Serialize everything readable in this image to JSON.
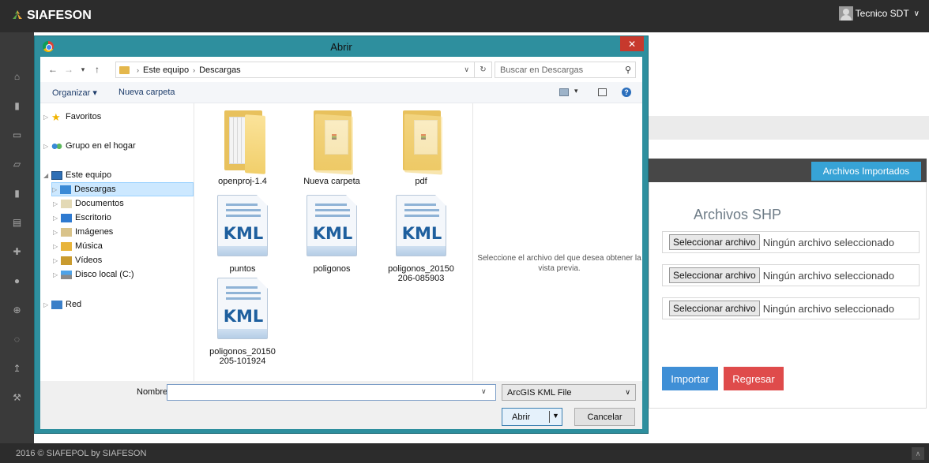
{
  "app": {
    "brand": "SIAFESON",
    "user": "Tecnico SDT",
    "user_chevron": "∨"
  },
  "sidebar": {
    "icons": [
      {
        "name": "home-icon",
        "glyph": "⌂"
      },
      {
        "name": "book-icon",
        "glyph": "▮"
      },
      {
        "name": "folder-icon",
        "glyph": "▭"
      },
      {
        "name": "folder-open-icon",
        "glyph": "▱"
      },
      {
        "name": "book2-icon",
        "glyph": "▮"
      },
      {
        "name": "file-icon",
        "glyph": "▤"
      },
      {
        "name": "puzzle-icon",
        "glyph": "✚"
      },
      {
        "name": "circle-icon",
        "glyph": "●"
      },
      {
        "name": "plus-circle-icon",
        "glyph": "⊕"
      },
      {
        "name": "spinner-icon",
        "glyph": "◌"
      },
      {
        "name": "upload-icon",
        "glyph": "↥"
      },
      {
        "name": "wrench-icon",
        "glyph": "⚒"
      }
    ]
  },
  "panel": {
    "imported_button": "Archivos Importados",
    "title": "Archivos SHP",
    "file_rows": [
      {
        "button": "Seleccionar archivo",
        "status": "Ningún archivo seleccionado"
      },
      {
        "button": "Seleccionar archivo",
        "status": "Ningún archivo seleccionado"
      },
      {
        "button": "Seleccionar archivo",
        "status": "Ningún archivo seleccionado"
      }
    ],
    "import_button": "Importar",
    "back_button": "Regresar"
  },
  "footer": {
    "text": "2016 © SIAFEPOL by SIAFESON",
    "up_icon": "∧"
  },
  "dialog": {
    "title": "Abrir",
    "close": "✕",
    "address": {
      "root": "Este equipo",
      "folder": "Descargas",
      "sep": "›",
      "chevron": "∨",
      "refresh": "↻"
    },
    "search_placeholder": "Buscar en Descargas",
    "nav": {
      "back": "←",
      "forward": "→",
      "dropdown": "▾",
      "up": "↑"
    },
    "toolbar": {
      "organize": "Organizar ▾",
      "new_folder": "Nueva carpeta",
      "view_dd": "▾",
      "help": "?"
    },
    "tree": {
      "favorites": "Favoritos",
      "homegroup": "Grupo en el hogar",
      "this_pc": "Este equipo",
      "children": [
        "Descargas",
        "Documentos",
        "Escritorio",
        "Imágenes",
        "Música",
        "Vídeos",
        "Disco local (C:)"
      ],
      "network": "Red"
    },
    "files": [
      {
        "name": "openproj-1.4",
        "type": "folder-doc"
      },
      {
        "name": "Nueva carpeta",
        "type": "folder"
      },
      {
        "name": "pdf",
        "type": "folder"
      },
      {
        "name": "puntos",
        "type": "kml"
      },
      {
        "name": "poligonos",
        "type": "kml"
      },
      {
        "name": "poligonos_20150\n206-085903",
        "type": "kml"
      },
      {
        "name": "poligonos_20150\n205-101924",
        "type": "kml"
      }
    ],
    "kml_label": "KML",
    "preview_text": "Seleccione el archivo del que desea obtener la vista previa.",
    "filename_label": "Nombre:",
    "filename_value": "",
    "filetype": "ArcGIS KML File",
    "open_button": "Abrir",
    "cancel_button": "Cancelar"
  },
  "colors": {
    "accent": "#37a3d6",
    "danger": "#df4b4b",
    "primary": "#3f8fd6",
    "dialog_frame": "#2e8f9e"
  }
}
